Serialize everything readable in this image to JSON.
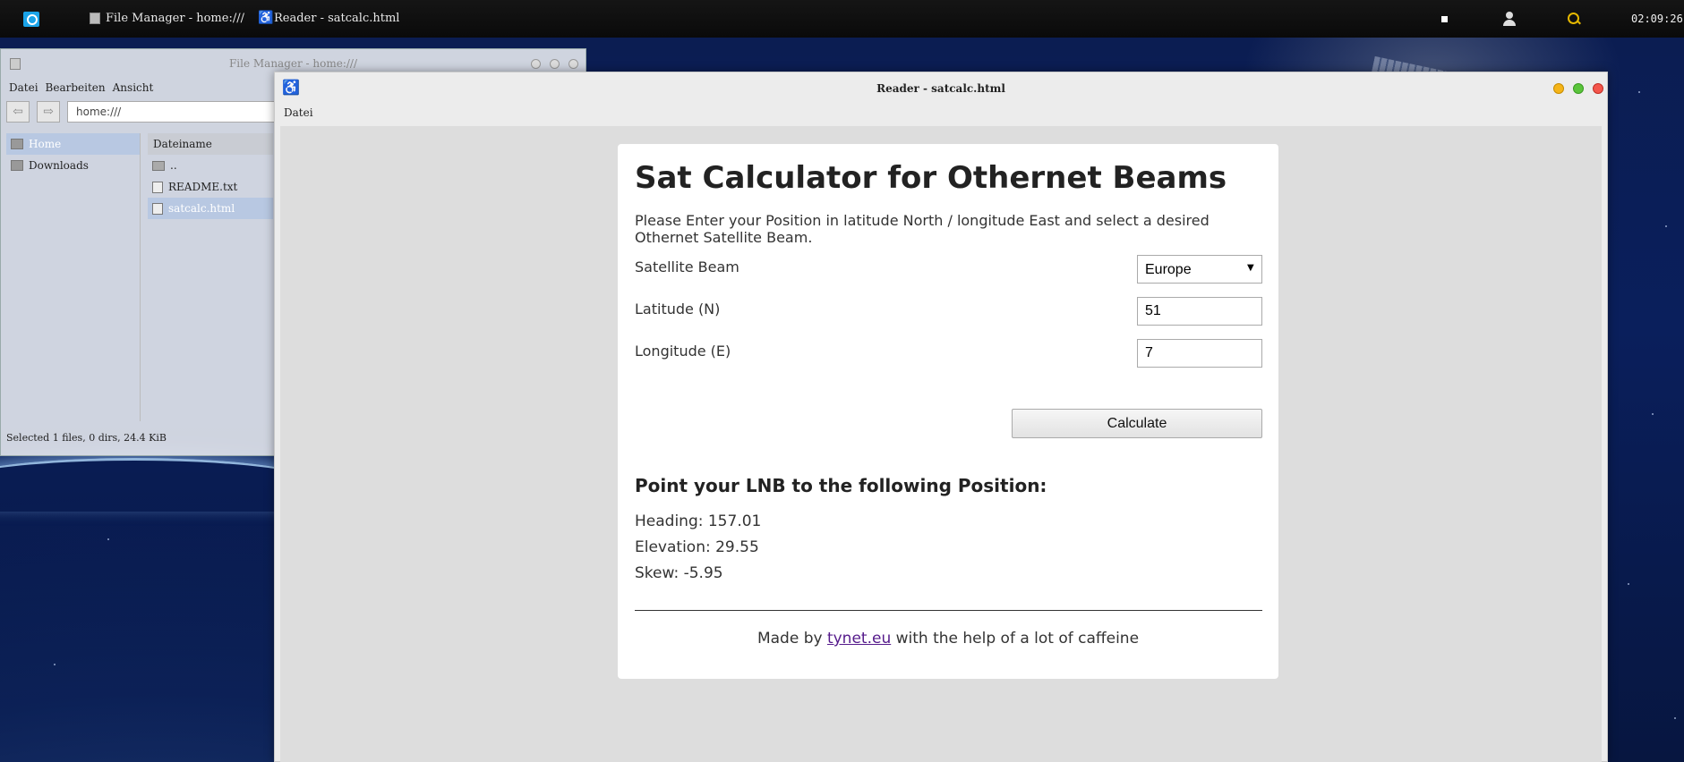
{
  "taskbar": {
    "tasks": [
      {
        "label": "File Manager - home:///"
      },
      {
        "label": "Reader - satcalc.html"
      }
    ],
    "clock": "02:09:26"
  },
  "file_manager": {
    "title": "File Manager - home:///",
    "menu": [
      "Datei",
      "Bearbeiten",
      "Ansicht"
    ],
    "back_glyph": "⇦",
    "forward_glyph": "⇨",
    "path": "home:///",
    "sidebar": [
      {
        "label": "Home",
        "selected": true
      },
      {
        "label": "Downloads",
        "selected": false
      }
    ],
    "column_header": "Dateiname",
    "files": [
      {
        "name": "..",
        "type": "folder"
      },
      {
        "name": "README.txt",
        "type": "text"
      },
      {
        "name": "satcalc.html",
        "type": "html",
        "selected": true
      }
    ],
    "status": "Selected 1 files, 0 dirs, 24.4 KiB"
  },
  "reader": {
    "title": "Reader - satcalc.html",
    "menu": [
      "Datei"
    ],
    "page": {
      "heading": "Sat Calculator for Othernet Beams",
      "intro": "Please Enter your Position in latitude North / longitude East and select a desired Othernet Satellite Beam.",
      "beam_label": "Satellite Beam",
      "beam_selected": "Europe",
      "latitude_label": "Latitude (N)",
      "latitude_value": "51",
      "longitude_label": "Longitude (E)",
      "longitude_value": "7",
      "calculate_label": "Calculate",
      "result_heading": "Point your LNB to the following Position:",
      "heading_result": "Heading: 157.01",
      "elevation_result": "Elevation: 29.55",
      "skew_result": "Skew: -5.95",
      "footer_prefix": "Made by",
      "footer_link": "tynet.eu",
      "footer_suffix": "with the help of a lot of caffeine"
    }
  }
}
